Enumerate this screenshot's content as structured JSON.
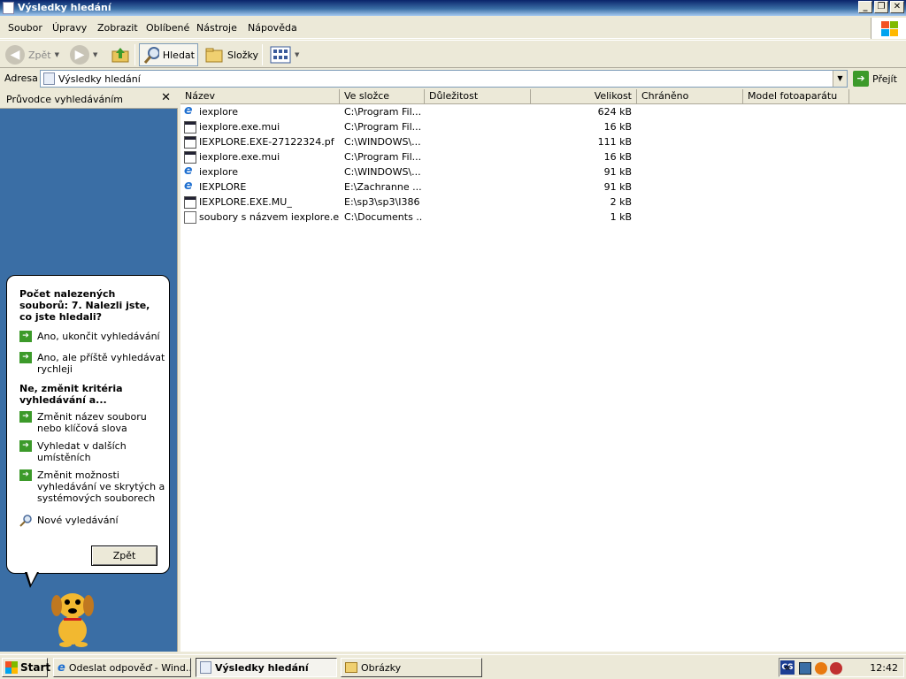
{
  "window": {
    "title": "Výsledky hledání"
  },
  "menu": [
    "Soubor",
    "Úpravy",
    "Zobrazit",
    "Oblíbené",
    "Nástroje",
    "Nápověda"
  ],
  "toolbar": {
    "back": "Zpět",
    "search": "Hledat",
    "folders": "Složky"
  },
  "address": {
    "label": "Adresa",
    "value": "Výsledky hledání",
    "go": "Přejít"
  },
  "pane": {
    "title": "Průvodce vyhledáváním",
    "heading1": "Počet nalezených souborů: 7. Nalezli jste, co jste hledali?",
    "link1": "Ano, ukončit vyhledávání",
    "link2": "Ano, ale příště vyhledávat rychleji",
    "heading2": "Ne, změnit kritéria vyhledávání a...",
    "link3": "Změnit název souboru nebo klíčová slova",
    "link4": "Vyhledat v dalších umístěních",
    "link5": "Změnit možnosti vyhledávání ve skrytých a systémových souborech",
    "link6": "Nové vyledávání",
    "back_button": "Zpět"
  },
  "columns": [
    "Název",
    "Ve složce",
    "Důležitost",
    "Velikost",
    "Chráněno",
    "Model fotoaparátu"
  ],
  "files": [
    {
      "name": "iexplore",
      "folder": "C:\\Program Fil...",
      "size": "624 kB",
      "icon": "ie-icon"
    },
    {
      "name": "iexplore.exe.mui",
      "folder": "C:\\Program Fil...",
      "size": "16 kB",
      "icon": "file-icon"
    },
    {
      "name": "IEXPLORE.EXE-27122324.pf",
      "folder": "C:\\WINDOWS\\...",
      "size": "111 kB",
      "icon": "file-icon"
    },
    {
      "name": "iexplore.exe.mui",
      "folder": "C:\\Program Fil...",
      "size": "16 kB",
      "icon": "file-icon"
    },
    {
      "name": "iexplore",
      "folder": "C:\\WINDOWS\\...",
      "size": "91 kB",
      "icon": "ie-icon"
    },
    {
      "name": "IEXPLORE",
      "folder": "E:\\Zachranne ...",
      "size": "91 kB",
      "icon": "ie-icon"
    },
    {
      "name": "IEXPLORE.EXE.MU_",
      "folder": "E:\\sp3\\sp3\\I386",
      "size": "2 kB",
      "icon": "file-icon"
    },
    {
      "name": "soubory s názvem iexplore.exe",
      "folder": "C:\\Documents ...",
      "size": "1 kB",
      "icon": "search-file-icon"
    }
  ],
  "taskbar": {
    "start": "Start",
    "items": [
      "Odeslat odpověď - Wind...",
      "Výsledky hledání",
      "Obrázky"
    ],
    "lang": "CS",
    "tray_chevron": "«",
    "clock": "12:42"
  },
  "colors": {
    "title_start": "#0a246a",
    "pane_bg": "#3a6ea5",
    "go_green": "#3c9a2a"
  }
}
